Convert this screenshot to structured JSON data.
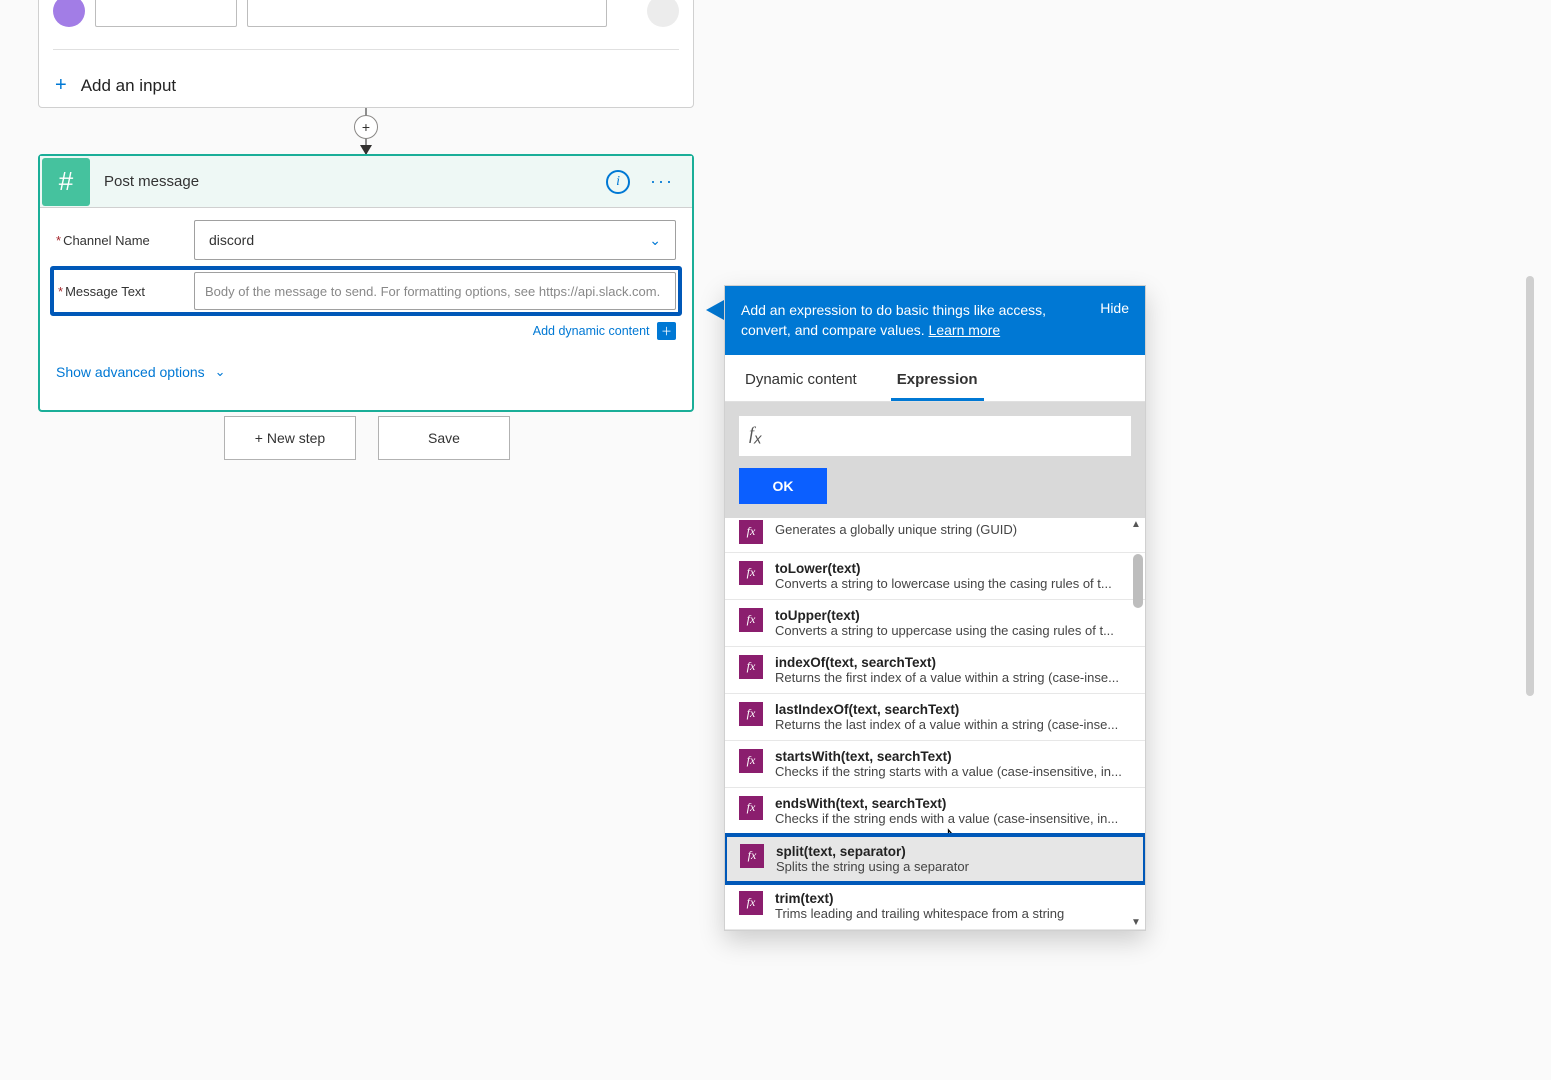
{
  "top": {
    "add_input_label": "Add an input"
  },
  "action": {
    "title": "Post message",
    "fields": {
      "channel_label": "Channel Name",
      "channel_value": "discord",
      "message_label": "Message Text",
      "message_placeholder": "Body of the message to send. For formatting options, see https://api.slack.com."
    },
    "add_dynamic": "Add dynamic content",
    "advanced": "Show advanced options"
  },
  "buttons": {
    "new_step": "+ New step",
    "save": "Save"
  },
  "popover": {
    "head_text_1": "Add an expression to do basic things like access, convert, and compare values. ",
    "learn_more": "Learn more",
    "hide": "Hide",
    "tabs": {
      "dynamic": "Dynamic content",
      "expression": "Expression"
    },
    "ok": "OK",
    "fx": "fx",
    "functions": [
      {
        "name": "",
        "desc": "Generates a globally unique string (GUID)",
        "partial": true
      },
      {
        "name": "toLower(text)",
        "desc": "Converts a string to lowercase using the casing rules of t..."
      },
      {
        "name": "toUpper(text)",
        "desc": "Converts a string to uppercase using the casing rules of t..."
      },
      {
        "name": "indexOf(text, searchText)",
        "desc": "Returns the first index of a value within a string (case-inse..."
      },
      {
        "name": "lastIndexOf(text, searchText)",
        "desc": "Returns the last index of a value within a string (case-inse..."
      },
      {
        "name": "startsWith(text, searchText)",
        "desc": "Checks if the string starts with a value (case-insensitive, in..."
      },
      {
        "name": "endsWith(text, searchText)",
        "desc": "Checks if the string ends with a value (case-insensitive, in..."
      },
      {
        "name": "split(text, separator)",
        "desc": "Splits the string using a separator",
        "highlight": true
      },
      {
        "name": "trim(text)",
        "desc": "Trims leading and trailing whitespace from a string"
      }
    ]
  }
}
